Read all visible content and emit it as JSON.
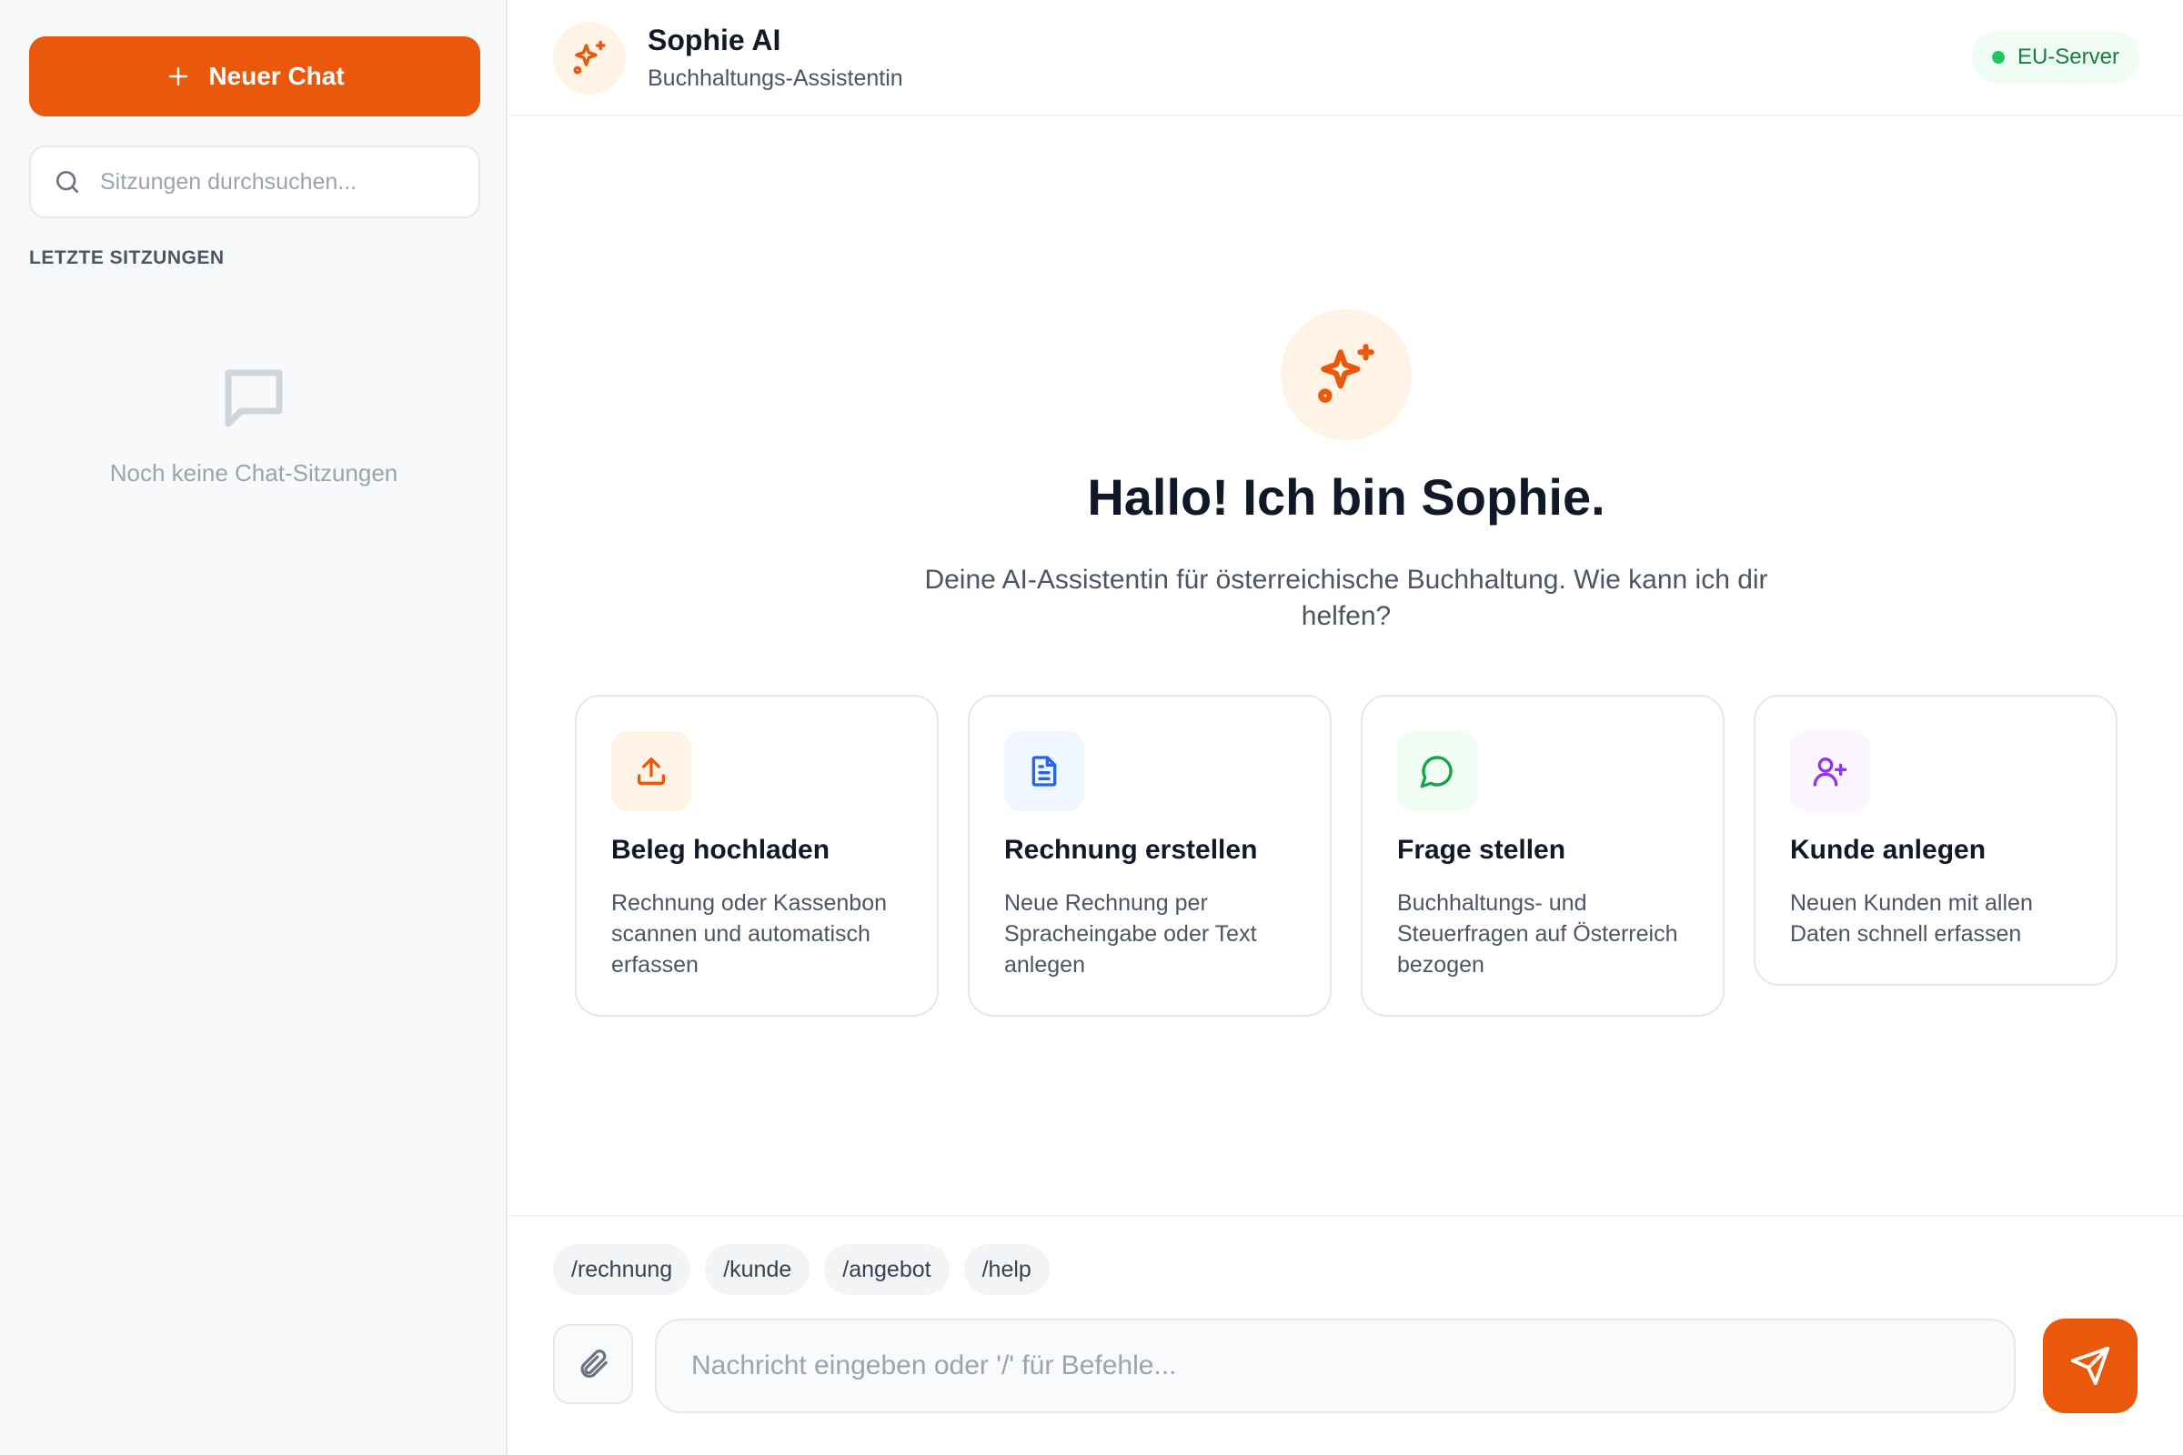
{
  "sidebar": {
    "new_chat_label": "Neuer Chat",
    "search_placeholder": "Sitzungen durchsuchen...",
    "section_label": "LETZTE SITZUNGEN",
    "empty_text": "Noch keine Chat-Sitzungen"
  },
  "header": {
    "title": "Sophie AI",
    "subtitle": "Buchhaltungs-Assistentin",
    "badge": "EU-Server"
  },
  "hero": {
    "title": "Hallo! Ich bin Sophie.",
    "subtitle": "Deine AI-Assistentin für österreichische Buchhaltung. Wie kann ich dir helfen?"
  },
  "cards": [
    {
      "title": "Beleg hochladen",
      "desc": "Rechnung oder Kassenbon scannen und automatisch erfassen",
      "icon": "upload-icon",
      "color": "#ea580c",
      "bg": "#fff3e6"
    },
    {
      "title": "Rechnung erstellen",
      "desc": "Neue Rechnung per Spracheingabe oder Text anlegen",
      "icon": "document-icon",
      "color": "#2563eb",
      "bg": "#eff6ff"
    },
    {
      "title": "Frage stellen",
      "desc": "Buchhaltungs- und Steuerfragen auf Österreich bezogen",
      "icon": "chat-bubble-icon",
      "color": "#16a34a",
      "bg": "#f0fdf4"
    },
    {
      "title": "Kunde anlegen",
      "desc": "Neuen Kunden mit allen Daten schnell erfassen",
      "icon": "user-plus-icon",
      "color": "#9333ea",
      "bg": "#faf5ff"
    }
  ],
  "composer": {
    "commands": [
      "/rechnung",
      "/kunde",
      "/angebot",
      "/help"
    ],
    "input_placeholder": "Nachricht eingeben oder '/' für Befehle...",
    "input_value": ""
  },
  "colors": {
    "accent": "#ea580c",
    "status_online": "#22c55e"
  }
}
